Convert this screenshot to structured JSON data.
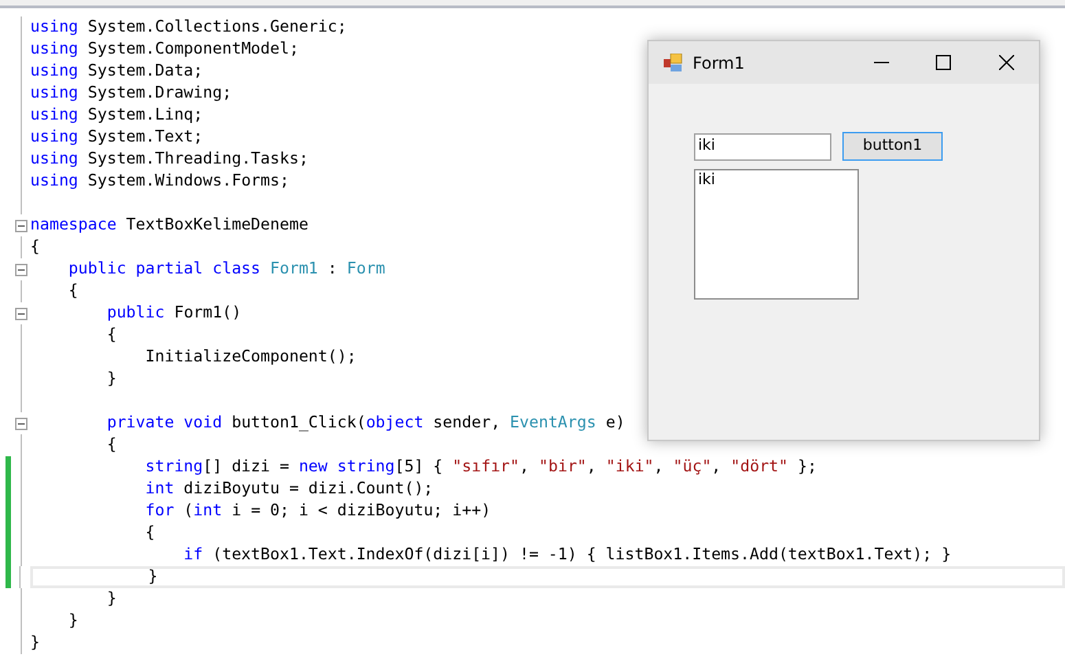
{
  "editor": {
    "blocks": [
      {
        "lines": [
          {
            "segments": [
              {
                "kind": "keyword",
                "text": "using"
              },
              {
                "kind": "plain",
                "text": " System.Collections.Generic;"
              }
            ],
            "changed": false,
            "current": false,
            "fold": false
          },
          {
            "segments": [
              {
                "kind": "keyword",
                "text": "using"
              },
              {
                "kind": "plain",
                "text": " System.ComponentModel;"
              }
            ],
            "changed": false,
            "current": false,
            "fold": false
          },
          {
            "segments": [
              {
                "kind": "keyword",
                "text": "using"
              },
              {
                "kind": "plain",
                "text": " System.Data;"
              }
            ],
            "changed": false,
            "current": false,
            "fold": false
          },
          {
            "segments": [
              {
                "kind": "keyword",
                "text": "using"
              },
              {
                "kind": "plain",
                "text": " System.Drawing;"
              }
            ],
            "changed": false,
            "current": false,
            "fold": false
          },
          {
            "segments": [
              {
                "kind": "keyword",
                "text": "using"
              },
              {
                "kind": "plain",
                "text": " System.Linq;"
              }
            ],
            "changed": false,
            "current": false,
            "fold": false
          },
          {
            "segments": [
              {
                "kind": "keyword",
                "text": "using"
              },
              {
                "kind": "plain",
                "text": " System.Text;"
              }
            ],
            "changed": false,
            "current": false,
            "fold": false
          },
          {
            "segments": [
              {
                "kind": "keyword",
                "text": "using"
              },
              {
                "kind": "plain",
                "text": " System.Threading.Tasks;"
              }
            ],
            "changed": false,
            "current": false,
            "fold": false
          },
          {
            "segments": [
              {
                "kind": "keyword",
                "text": "using"
              },
              {
                "kind": "plain",
                "text": " System.Windows.Forms;"
              }
            ],
            "changed": false,
            "current": false,
            "fold": false
          }
        ]
      },
      {
        "lines": [
          {
            "segments": [
              {
                "kind": "keyword",
                "text": "namespace"
              },
              {
                "kind": "plain",
                "text": " TextBoxKelimeDeneme"
              }
            ],
            "changed": false,
            "current": false,
            "fold": true,
            "expanded": true
          },
          {
            "segments": [
              {
                "kind": "plain",
                "text": "{"
              }
            ],
            "changed": false,
            "current": false,
            "fold": false
          },
          {
            "segments": [
              {
                "kind": "keyword",
                "text": "    public partial class "
              },
              {
                "kind": "type",
                "text": "Form1"
              },
              {
                "kind": "plain",
                "text": " : "
              },
              {
                "kind": "type",
                "text": "Form"
              }
            ],
            "changed": false,
            "current": false,
            "fold": true,
            "expanded": true
          },
          {
            "segments": [
              {
                "kind": "plain",
                "text": "    {"
              }
            ],
            "changed": false,
            "current": false,
            "fold": false
          },
          {
            "segments": [
              {
                "kind": "keyword",
                "text": "        public"
              },
              {
                "kind": "plain",
                "text": " Form1()"
              }
            ],
            "changed": false,
            "current": false,
            "fold": true,
            "expanded": true
          },
          {
            "segments": [
              {
                "kind": "plain",
                "text": "        {"
              }
            ],
            "changed": false,
            "current": false,
            "fold": false
          },
          {
            "segments": [
              {
                "kind": "plain",
                "text": "            InitializeComponent();"
              }
            ],
            "changed": false,
            "current": false,
            "fold": false
          },
          {
            "segments": [
              {
                "kind": "plain",
                "text": "        }"
              }
            ],
            "changed": false,
            "current": false,
            "fold": false
          }
        ]
      },
      {
        "lines": [
          {
            "segments": [
              {
                "kind": "keyword",
                "text": "        private void"
              },
              {
                "kind": "plain",
                "text": " button1_Click("
              },
              {
                "kind": "keyword",
                "text": "object"
              },
              {
                "kind": "plain",
                "text": " sender, "
              },
              {
                "kind": "type",
                "text": "EventArgs"
              },
              {
                "kind": "plain",
                "text": " e)"
              }
            ],
            "changed": false,
            "current": false,
            "fold": true,
            "expanded": true
          },
          {
            "segments": [
              {
                "kind": "plain",
                "text": "        {"
              }
            ],
            "changed": false,
            "current": false,
            "fold": false
          },
          {
            "segments": [
              {
                "kind": "keyword",
                "text": "            string"
              },
              {
                "kind": "plain",
                "text": "[] dizi = "
              },
              {
                "kind": "keyword",
                "text": "new string"
              },
              {
                "kind": "plain",
                "text": "[5] { "
              },
              {
                "kind": "string",
                "text": "\"sıfır\""
              },
              {
                "kind": "plain",
                "text": ", "
              },
              {
                "kind": "string",
                "text": "\"bir\""
              },
              {
                "kind": "plain",
                "text": ", "
              },
              {
                "kind": "string",
                "text": "\"iki\""
              },
              {
                "kind": "plain",
                "text": ", "
              },
              {
                "kind": "string",
                "text": "\"üç\""
              },
              {
                "kind": "plain",
                "text": ", "
              },
              {
                "kind": "string",
                "text": "\"dört\""
              },
              {
                "kind": "plain",
                "text": " };"
              }
            ],
            "changed": true,
            "current": false,
            "fold": false
          },
          {
            "segments": [
              {
                "kind": "keyword",
                "text": "            int"
              },
              {
                "kind": "plain",
                "text": " diziBoyutu = dizi.Count();"
              }
            ],
            "changed": true,
            "current": false,
            "fold": false
          },
          {
            "segments": [
              {
                "kind": "keyword",
                "text": "            for"
              },
              {
                "kind": "plain",
                "text": " ("
              },
              {
                "kind": "keyword",
                "text": "int"
              },
              {
                "kind": "plain",
                "text": " i = 0; i < diziBoyutu; i++)"
              }
            ],
            "changed": true,
            "current": false,
            "fold": false
          },
          {
            "segments": [
              {
                "kind": "plain",
                "text": "            {"
              }
            ],
            "changed": true,
            "current": false,
            "fold": false
          },
          {
            "segments": [
              {
                "kind": "keyword",
                "text": "                if"
              },
              {
                "kind": "plain",
                "text": " (textBox1.Text.IndexOf(dizi[i]) != -1) { listBox1.Items.Add(textBox1.Text); }"
              }
            ],
            "changed": true,
            "current": false,
            "fold": false
          },
          {
            "segments": [
              {
                "kind": "plain",
                "text": "            }"
              }
            ],
            "changed": true,
            "current": true,
            "fold": false
          },
          {
            "segments": [
              {
                "kind": "plain",
                "text": "        }"
              }
            ],
            "changed": false,
            "current": false,
            "fold": false
          },
          {
            "segments": [
              {
                "kind": "plain",
                "text": "    }"
              }
            ],
            "changed": false,
            "current": false,
            "fold": false
          },
          {
            "segments": [
              {
                "kind": "plain",
                "text": "}"
              }
            ],
            "changed": false,
            "current": false,
            "fold": false
          }
        ]
      }
    ]
  },
  "form_window": {
    "title": "Form1",
    "textbox": {
      "value": "iki"
    },
    "button": {
      "label": "button1",
      "focused": true
    },
    "listbox": {
      "items": [
        "iki"
      ]
    }
  }
}
